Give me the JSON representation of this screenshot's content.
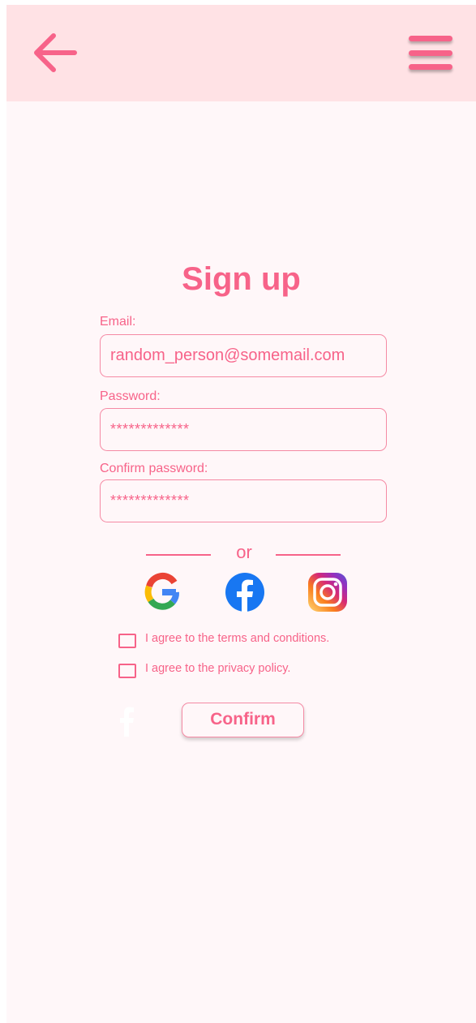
{
  "header": {
    "back_icon": "arrow-left-icon",
    "menu_icon": "hamburger-menu-icon"
  },
  "form": {
    "title": "Sign up",
    "email_label": "Email:",
    "email_value": "random_person@somemail.com",
    "password_label": "Password:",
    "password_value": "*************",
    "confirm_label": "Confirm password:",
    "confirm_value": "*************",
    "or_text": "or"
  },
  "social": [
    {
      "name": "Google",
      "icon": "google-icon"
    },
    {
      "name": "Facebook",
      "icon": "facebook-icon"
    },
    {
      "name": "Instagram",
      "icon": "instagram-icon"
    }
  ],
  "agreements": {
    "terms_label": "I agree to the terms and conditions.",
    "terms_checked": false,
    "privacy_label": "I agree to the privacy policy.",
    "privacy_checked": false
  },
  "confirm_label": "Confirm",
  "colors": {
    "accent": "#f76389",
    "header_bg": "#ffe2e5",
    "page_bg": "#fff7f9",
    "border": "#f58aa4"
  }
}
